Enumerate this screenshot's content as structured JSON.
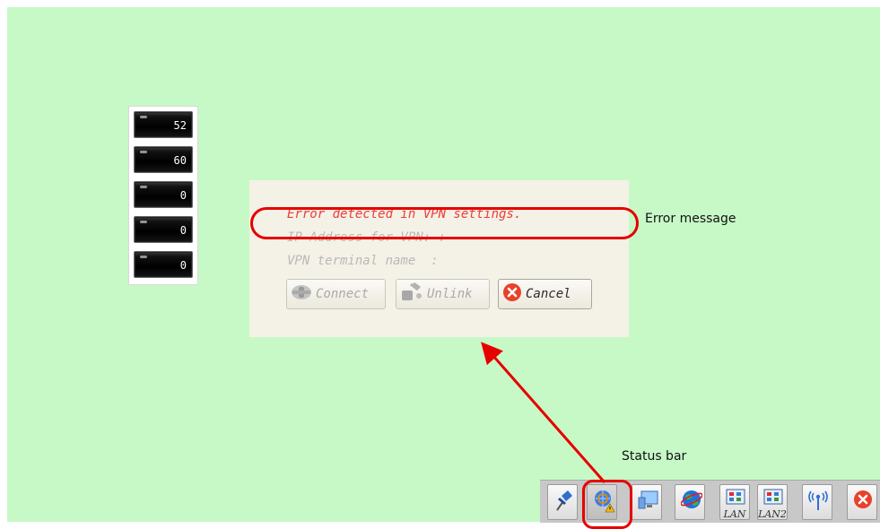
{
  "numeric_displays": [
    "52",
    "60",
    "0",
    "0",
    "0"
  ],
  "dialog": {
    "error_message": "Error detected in VPN settings.",
    "ip_label": "IP Address for VPN: :",
    "vpn_name_label": "VPN terminal name  :",
    "buttons": {
      "connect": "Connect",
      "unlink": "Unlink",
      "cancel": "Cancel"
    }
  },
  "annotations": {
    "error_label": "Error message",
    "status_label": "Status bar"
  },
  "status_bar": {
    "items": [
      {
        "icon": "pin-icon",
        "sub": ""
      },
      {
        "icon": "vpn-warning-icon",
        "sub": ""
      },
      {
        "icon": "monitor-icon",
        "sub": ""
      },
      {
        "icon": "globe-icon",
        "sub": ""
      },
      {
        "icon": "lan-icon",
        "sub": "LAN"
      },
      {
        "icon": "lan2-icon",
        "sub": "LAN2"
      },
      {
        "icon": "wireless-icon",
        "sub": ""
      },
      {
        "icon": "close-icon",
        "sub": ""
      }
    ]
  },
  "colors": {
    "screen_bg": "#c7f9c7",
    "dialog_bg": "#f4f1e6",
    "error_text": "#ef3b3b",
    "highlight": "#e60000"
  }
}
